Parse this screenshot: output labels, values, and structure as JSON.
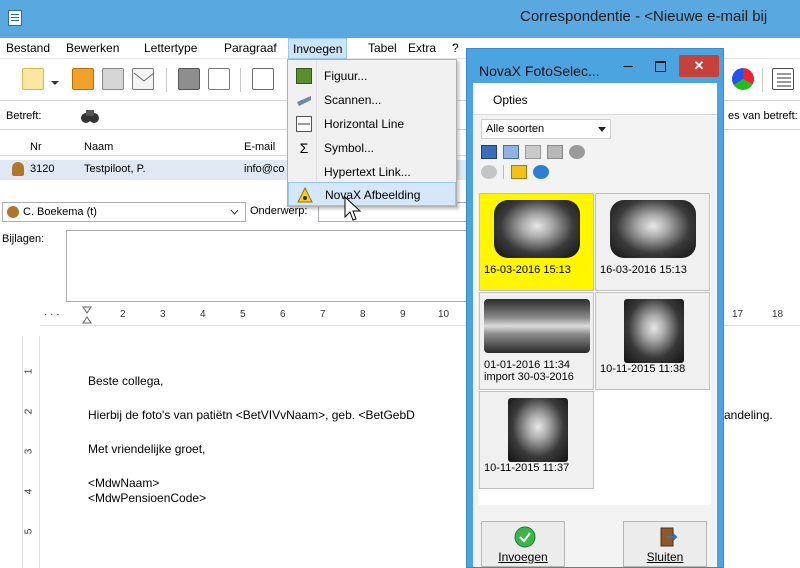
{
  "window": {
    "title": "Correspondentie - <Nieuwe e-mail bij"
  },
  "menubar": [
    "Bestand",
    "Bewerken",
    "Lettertype",
    "Paragraaf",
    "Invoegen",
    "Tabel",
    "Extra",
    "?"
  ],
  "betreft": {
    "label": "Betreft:",
    "right_text": "es van betreft:"
  },
  "grid": {
    "headers": [
      "Nr",
      "Naam",
      "E-mail"
    ],
    "row": {
      "nr": "3120",
      "naam": "Testpiloot, P.",
      "email": "info@co"
    }
  },
  "contact": {
    "value": "C. Boekema (t)",
    "onderwerp_label": "Onderwerp:"
  },
  "bijlagen_label": "Bijlagen:",
  "ruler_marks": [
    "2",
    "3",
    "4",
    "5",
    "6",
    "7",
    "8",
    "9",
    "10",
    "17",
    "18"
  ],
  "vruler_marks": [
    "1",
    "2",
    "3",
    "4",
    "5"
  ],
  "document": {
    "lines": [
      "Beste collega,",
      "Hierbij de foto's van patiëtn <BetVIVvNaam>, geb. <BetGebD",
      "andeling.",
      "Met vriendelijke groet,",
      "<MdwNaam>",
      "<MdwPensioenCode>"
    ]
  },
  "dropdown": {
    "items": [
      {
        "label": "Figuur...",
        "icon": "image-icon"
      },
      {
        "label": "Scannen...",
        "icon": "scanner-icon"
      },
      {
        "label": "Horizontal Line",
        "icon": "horizontal-line-icon"
      },
      {
        "label": "Symbol...",
        "icon": "sigma-icon"
      },
      {
        "label": "Hypertext Link...",
        "icon": ""
      },
      {
        "label": "NovaX Afbeelding",
        "icon": "radiation-icon"
      }
    ]
  },
  "nova": {
    "title": "NovaX FotoSelec...",
    "close": "✕",
    "opties": "Opties",
    "filter": "Alle soorten",
    "thumbs": [
      {
        "caption": "16-03-2016 15:13",
        "selected": true
      },
      {
        "caption": "16-03-2016 15:13",
        "selected": false
      },
      {
        "caption": "01-01-2016 11:34",
        "caption2": "import 30-03-2016",
        "selected": false
      },
      {
        "caption": "10-11-2015 11:38",
        "selected": false
      },
      {
        "caption": "10-11-2015 11:37",
        "selected": false
      }
    ],
    "insert_label": "Invoegen",
    "close_label": "Sluiten"
  },
  "colors": {
    "titlebar": "#5aa8e0",
    "nova_frame": "#4ba3e0",
    "selected_thumb": "#fff600",
    "close_red": "#c7413b"
  }
}
